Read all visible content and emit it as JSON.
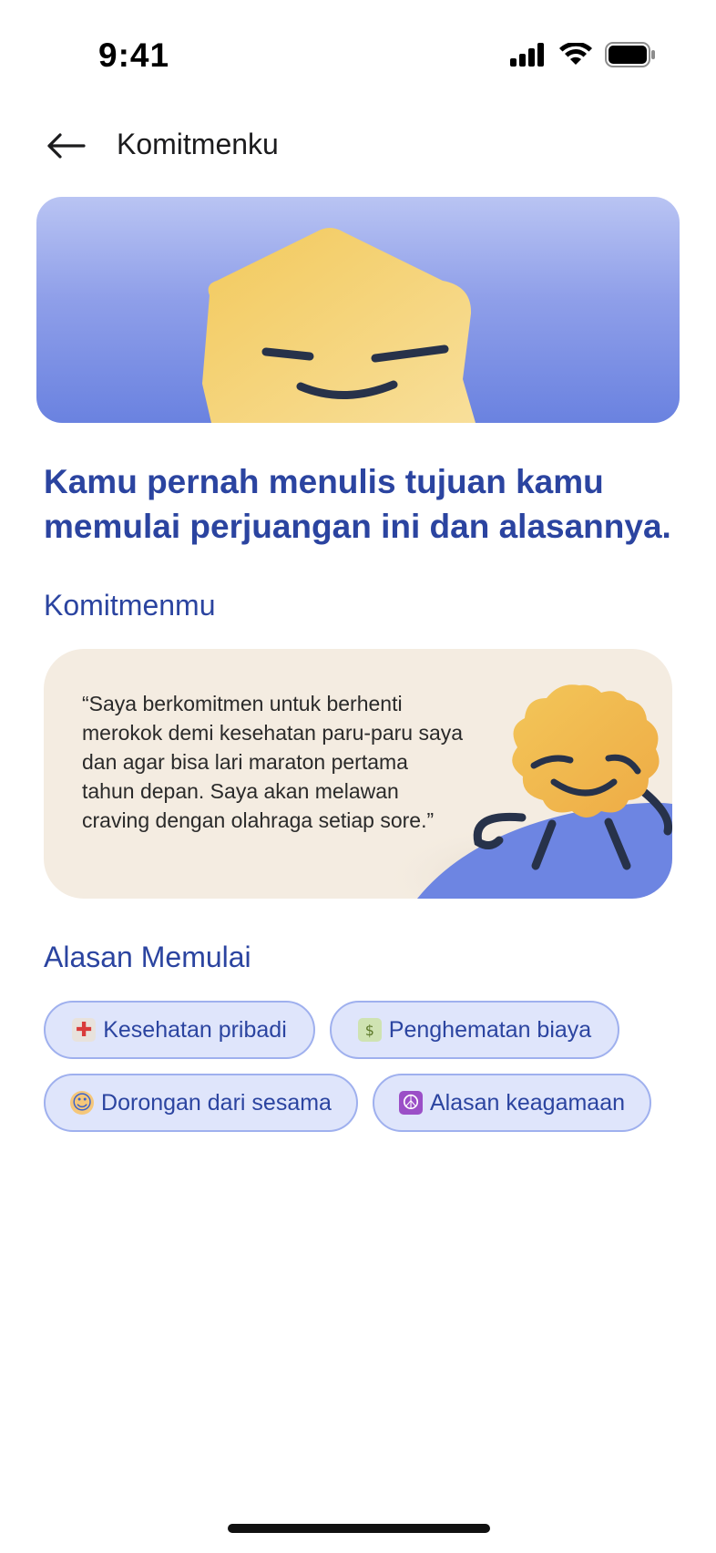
{
  "status_bar": {
    "time": "9:41"
  },
  "header": {
    "title": "Komitmenku"
  },
  "headline": "Kamu pernah menulis tujuan kamu memulai perjuangan ini dan alasannya.",
  "commitment": {
    "section_title": "Komitmenmu",
    "quote": "“Saya berkomitmen untuk berhenti merokok demi kesehatan paru-paru saya dan agar bisa lari maraton pertama tahun depan. Saya akan melawan craving dengan olahraga setiap sore.”"
  },
  "reasons": {
    "section_title": "Alasan Memulai",
    "chips": [
      {
        "icon": "hospital-icon",
        "label": "Kesehatan pribadi"
      },
      {
        "icon": "money-icon",
        "label": "Penghematan biaya"
      },
      {
        "icon": "person-gesturing-icon",
        "label": "Dorongan dari sesama"
      },
      {
        "icon": "peace-symbol-icon",
        "label": "Alasan keagamaan"
      }
    ]
  },
  "colors": {
    "accent": "#2b44a0",
    "chip_bg": "#dfe5fb",
    "chip_border": "#9fb0ee",
    "card_bg": "#f4ece1",
    "mascot_yellow": "#f4c95a",
    "hero_blue": "#6a82e0"
  }
}
